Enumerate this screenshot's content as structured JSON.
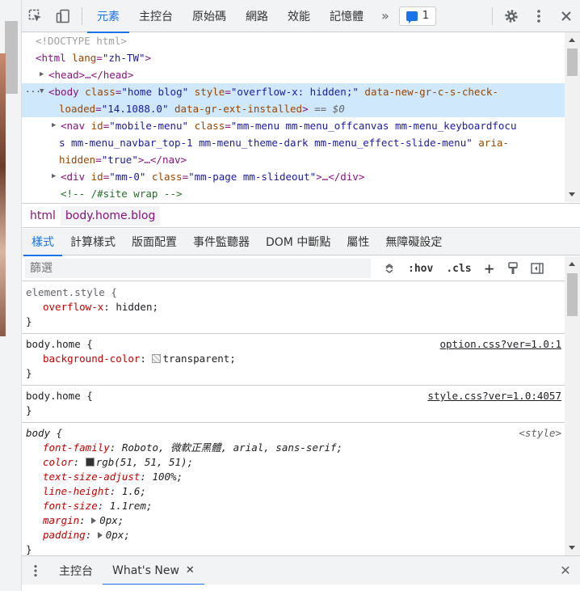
{
  "toolbar": {
    "tabs": [
      "元素",
      "主控台",
      "原始碼",
      "網路",
      "效能",
      "記憶體"
    ],
    "active_tab": "元素",
    "more_label": "»",
    "issues_count": "1"
  },
  "dom": {
    "doctype": "<!DOCTYPE html>",
    "html_open": "<html",
    "html_lang_attr": "lang",
    "html_lang_val": "\"zh-TW\"",
    "head_collapsed": "<head>…</head>",
    "body_ellipsis": "…",
    "body_tag": "<body",
    "body_class_attr": "class",
    "body_class_val": "\"home blog\"",
    "body_style_attr": "style",
    "body_style_val": "\"overflow-x: hidden;\"",
    "body_gr_attr": "data-new-gr-c-s-check-",
    "body_gr_attr2": "loaded",
    "body_gr_val": "\"14.1088.0\"",
    "body_ext_attr": "data-gr-ext-installed",
    "body_end": ">",
    "body_eq": "== $0",
    "nav_tag": "<nav",
    "nav_id_attr": "id",
    "nav_id_val": "\"mobile-menu\"",
    "nav_class_attr": "class",
    "nav_class_val1": "\"mm-menu mm-menu_offcanvas mm-menu_keyboardfocu",
    "nav_class_val2": "s mm-menu_navbar_top-1 mm-menu_theme-dark mm-menu_effect-slide-menu\"",
    "nav_aria_attr": "aria-",
    "nav_aria_attr2": "hidden",
    "nav_aria_val": "\"true\"",
    "nav_tail": ">…</nav>",
    "div_tag": "<div",
    "div_id_attr": "id",
    "div_id_val": "\"mm-0\"",
    "div_class_attr": "class",
    "div_class_val": "\"mm-page mm-slideout\"",
    "div_tail": ">…</div>",
    "comment": "<!-- /#site wrap -->"
  },
  "breadcrumb": {
    "items": [
      "html",
      "body.home.blog"
    ]
  },
  "style_tabs": [
    "樣式",
    "計算樣式",
    "版面配置",
    "事件監聽器",
    "DOM 中斷點",
    "屬性",
    "無障礙設定"
  ],
  "filter": {
    "placeholder": "篩選",
    "hov": ":hov",
    "cls": ".cls",
    "plus": "+"
  },
  "rules": {
    "r1": {
      "selector": "element.style {",
      "prop": "overflow-x",
      "value": "hidden;",
      "close": "}"
    },
    "r2": {
      "selector": "body.home {",
      "source": "option.css?ver=1.0:1",
      "prop": "background-color",
      "value": "transparent;",
      "close": "}"
    },
    "r3": {
      "selector": "body.home {",
      "source": "style.css?ver=1.0:4057",
      "close": "}"
    },
    "r4": {
      "selector": "body {",
      "source": "<style>",
      "decls": [
        {
          "prop": "font-family",
          "value": "Roboto, 微軟正黑體, arial, sans-serif;"
        },
        {
          "prop": "color",
          "value": "rgb(51, 51, 51);"
        },
        {
          "prop": "text-size-adjust",
          "value": "100%;"
        },
        {
          "prop": "line-height",
          "value": "1.6;"
        },
        {
          "prop": "font-size",
          "value": "1.1rem;"
        },
        {
          "prop": "margin",
          "value": "0px;"
        },
        {
          "prop": "padding",
          "value": "0px;"
        }
      ],
      "close": "}"
    }
  },
  "drawer": {
    "tabs": [
      "主控台",
      "What's New"
    ],
    "close_tab": "✕",
    "close_drawer": "✕"
  },
  "colors": {
    "accent": "#1a73e8",
    "selected_row": "#cfe8fc",
    "tag": "#881280",
    "attr_name": "#994500",
    "attr_value": "#1a1aa6",
    "prop_name": "#c80000"
  },
  "icons": [
    "inspect-icon",
    "device-toggle-icon",
    "chat-icon",
    "gear-icon",
    "kebab-icon",
    "close-icon",
    "filter-toggle-icon",
    "paint-icon",
    "sidebar-icon"
  ]
}
